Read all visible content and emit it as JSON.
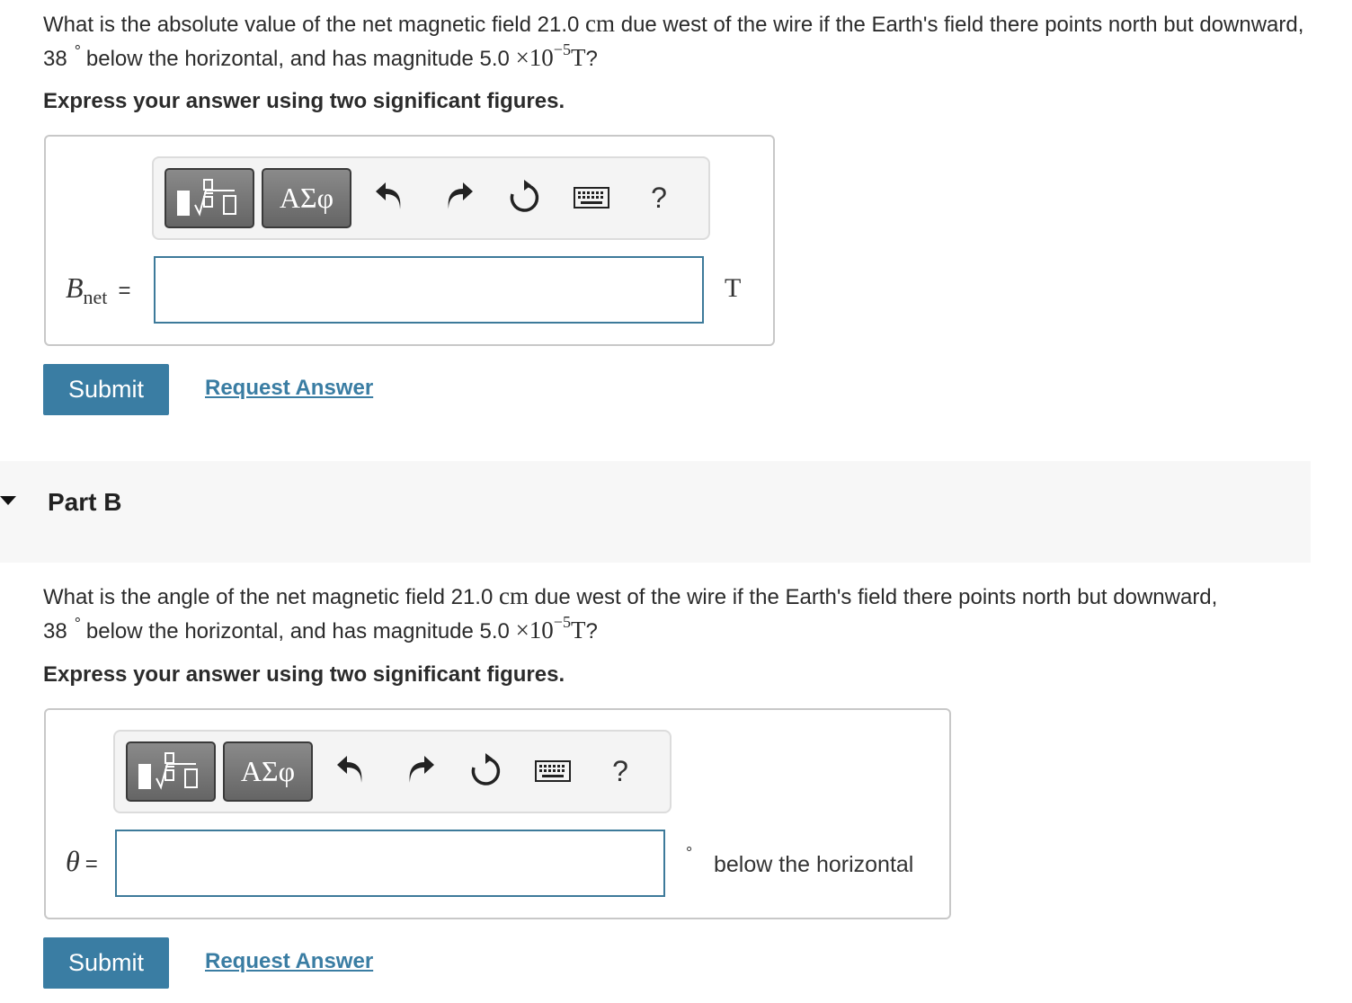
{
  "partA": {
    "question": {
      "text1": "What is the absolute value of the net magnetic field 21.0 ",
      "unit_cm": "cm",
      "text2": " due west of the wire if the Earth's field there points north but downward, 38",
      "degree": "°",
      "text3": "below the horizontal, and has magnitude 5.0 ",
      "times_ten": "×10",
      "exponent": "−5",
      "unit_T": "T",
      "end": "?"
    },
    "instruction": "Express your answer using two significant figures.",
    "toolbar": {
      "greek_label": "ΑΣφ",
      "help_label": "?"
    },
    "variable": "B",
    "subscript": "net",
    "equals": "=",
    "unit": "T",
    "input_value": "",
    "submit_label": "Submit",
    "request_label": "Request Answer"
  },
  "partB": {
    "title": "Part B",
    "question": {
      "text1": "What is the angle of the net magnetic field 21.0 ",
      "unit_cm": "cm",
      "text2": " due west of the wire if the Earth's field there points north but downward, 38",
      "degree": "°",
      "text3": "below the horizontal, and has magnitude 5.0 ",
      "times_ten": "×10",
      "exponent": "−5",
      "unit_T": "T",
      "end": "?"
    },
    "instruction": "Express your answer using two significant figures.",
    "toolbar": {
      "greek_label": "ΑΣφ",
      "help_label": "?"
    },
    "variable": "θ",
    "equals": "=",
    "unit_degree": "°",
    "unit_text": "below the horizontal",
    "input_value": "",
    "submit_label": "Submit",
    "request_label": "Request Answer"
  }
}
